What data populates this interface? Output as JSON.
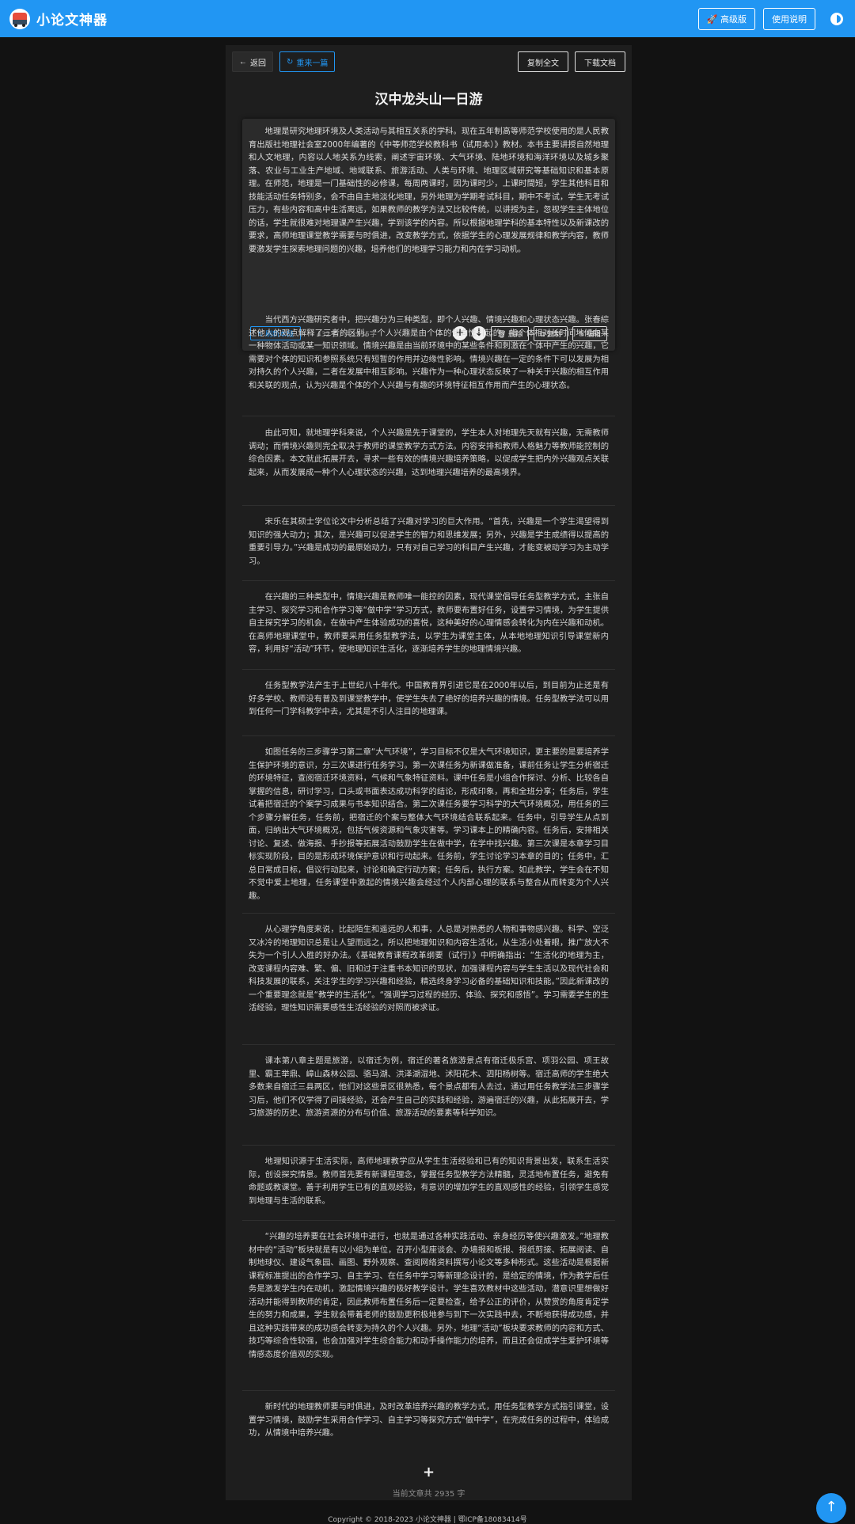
{
  "navbar": {
    "brand": "小论文神器",
    "premium_label": "🚀 高级版",
    "help_label": "使用说明"
  },
  "toolbar": {
    "back_label": "返回",
    "regen_label": "重来一篇",
    "copy_all_label": "复制全文",
    "download_label": "下载文档"
  },
  "article": {
    "title": "汉中龙头山一日游",
    "paragraphs": [
      "地理是研究地理环境及人类活动与其相互关系的学科。现在五年制高等师范学校使用的是人民教育出版社地理社会室2000年编著的《中等师范学校教科书（试用本）》教材。本书主要讲授自然地理和人文地理，内容以人地关系为线索，阐述宇宙环境、大气环境、陆地环境和海洋环境以及城乡聚落、农业与工业生产地域、地域联系、旅游活动、人类与环境、地理区域研究等基础知识和基本原理。在师范，地理是一门基础性的必修课，每周两课时，因为课时少，上课时間短，学生其他科目和技能活动任务特别多，会不由自主地淡化地理，另外地理为学期考试科目，期中不考试，学生无考试压力，有些内容和高中生活离远，如果教师的教学方法又比较传统，以讲授为主，忽视学生主体地位的话，学生就很难对地理课产生兴趣，学到该学的内容。所以根据地理学科的基本特性以及新课改的要求，高师地理课堂教学需要与时俱进，改变教学方式，依据学生的心理发展规律和教学内容，教师要激发学生探索地理问题的兴趣，培养他们的地理学习能力和内在学习动机。",
      "当代西方兴趣研究者中，把兴趣分为三种类型，即个人兴趣、情境兴趣和心理状态兴趣。张春綜述他人的观点解释了三者的区别。“个人兴趣是由个体的倾向性引起的，指个体相对长时间地倾向某一种物体活动或某一知识领域。情境兴趣是由当前环境中的某些条件和刺激在个体中产生的兴趣，它需要对个体的知识和参照系统只有短暂的作用并边缘性影响。情境兴趣在一定的条件下可以发展为相对持久的个人兴趣，二者在发展中相互影响。兴趣作为一种心理状态反映了一种关于兴趣的相互作用和关联的观点，认为兴趣是个体的个人兴趣与有趣的环境特征相互作用而产生的心理状态。",
      "由此可知，就地理学科来说，个人兴趣是先于课堂的，学生本人对地理先天就有兴趣，无需教师调动；而情境兴趣则完全取决于教师的课堂教学方式方法。内容安排和教师人格魅力等教师能控制的综合因素。本文就此拓展开去，寻求一些有效的情境兴趣培养策略，以促成学生把内外兴趣观点关联起来，从而发展成一种个人心理状态的兴趣，达到地理兴趣培养的最高境界。",
      "宋乐在其硕士学位论文中分析总结了兴趣对学习的巨大作用。“首先，兴趣是一个学生渴望得到知识的强大动力；其次，是兴趣可以促进学生的智力和思维发展；另外，兴趣是学生成绩得以提高的重要引导力。”兴趣是成功的最原始动力，只有对自己学习的科目产生兴趣，才能变被动学习为主动学习。",
      "在兴趣的三种类型中，情境兴趣是教师唯一能控的因素，现代课堂倡导任务型教学方式，主张自主学习、探究学习和合作学习等“做中学”学习方式，教师要布置好任务，设置学习情境，为学生提供自主探究学习的机会，在做中产生体验成功的喜悦，这种美好的心理情感会转化为内在兴趣和动机。在高师地理课堂中，教师要采用任务型教学法，以学生为课堂主体，从本地地理知识引导课堂新内容，利用好“活动”环节，使地理知识生活化，逐渐培养学生的地理情境兴趣。",
      "任务型教学法产生于上世纪八十年代。中国教育界引进它是在2000年以后，到目前为止还是有好多学校、教师没有普及到课堂教学中，使学生失去了绝好的培养兴趣的情境。任务型教学法可以用到任何一门学科教学中去，尤其是不引人注目的地理课。",
      "如图任务的三步骤学习第二章“大气环境”，学习目标不仅是大气环境知识，更主要的是要培养学生保护环境的意识，分三次课进行任务学习。第一次课任务为新课做准备，课前任务让学生分析宿迁的环境特征，查阅宿迁环境资料，气候和气象特征资料。课中任务是小组合作探讨、分析、比较各自掌握的信息，研讨学习，口头或书面表达成功科学的结论，形成印象，再和全班分享；任务后，学生试着把宿迁的个案学习成果与书本知识结合。第二次课任务要学习科学的大气环境概况，用任务的三个步骤分解任务，任务前，把宿迁的个案与整体大气环境结合联系起来。任务中，引导学生从点到面，归纳出大气环境概况，包括气候资源和气象灾害等。学习课本上的精确内容。任务后，安排相关讨论、复述、做海报、手抄报等拓展活动鼓励学生在做中学，在学中找兴趣。第三次课是本章学习目标实现阶段，目的是形成环境保护意识和行动起来。任务前，学生讨论学习本章的目的；任务中，汇总日常成日标，倡议行动起来，讨论和确定行动方案；任务后，执行方案。如此教学，学生会在不知不觉中爱上地理，任务课堂中激起的情境兴趣会经过个人内部心理的联系与整合从而转变为个人兴趣。",
      "从心理学角度来说，比起陌生和遥远的人和事，人总是对熟悉的人物和事物感兴趣。科学、空泛又冰冷的地理知识总是让人望而远之，所以把地理知识和内容生活化，从生活小处着眼，推广放大不失为一个引人入胜的好办法。《基础教育课程改革纲要（试行）》中明确指出：“生活化的地理为主，改变课程内容难、繁、偏、旧和过于注重书本知识的现状，加强课程内容与学生生活以及现代社会和科技发展的联系，关注学生的学习兴趣和经验，精选终身学习必备的基础知识和技能。”因此新课改的一个重要理念就是“教学的生活化”。“强调学习过程的经历、体验、探究和感悟”。学习需要学生的生活经验，理性知识需要感性生活经验的对照而被求证。",
      "课本第八章主题是旅游，以宿迁为例，宿迁的著名旅游景点有宿迁极乐宫、项羽公园、项王故里、霸王举鼎、嶂山森林公园、骆马湖、洪泽湖湿地、沭阳花木、泗阳杨树等。宿迁高师的学生绝大多数来自宿迁三县两区，他们对这些景区很熟悉，每个景点都有人去过，通过用任务教学法三步骤学习后，他们不仅学得了间接经验，还会产生自己的实践和经验，游遍宿迁的兴趣，从此拓展开去，学习旅游的历史、旅游资源的分布与价值、旅游活动的要素等科学知识。",
      "地理知识源于生活实际，高师地理教学应从学生生活经验和已有的知识背景出发，联系生活实际，创设探究情景。教师首先要有新课程理念，掌握任务型教学方法精髓，灵活地布置任务，避免有命题或教课堂。善于利用学生已有的直观经验，有意识的增加学生的直观感性的经验，引领学生感觉到地理与生活的联系。",
      "“兴趣的培养要在社会环境中进行，也就是通过各种实践活动、亲身经历等使兴趣激发。”地理教材中的“活动”板块就是有以小组为单位，召开小型座谈会、办墙报和板报、报纸剪接、拓展阅读、自制地球仪、建设气象园、画图、野外观察、查阅网络资料撰写小论文等多种形式。这些活动是根据新课程标准提出的合作学习、自主学习、在任务中学习等新理念设计的，是给定的情境，作为教学后任务是激发学生内在动机，激起情境兴趣的极好教学设计。学生喜欢教材中这些活动，潜意识里想做好活动并能得到教师的肯定，因此教师布置任务后一定要检查，给予公正的评价，从赞赏的角度肯定学生的努力和成果，学生就会带着老师的鼓励更积极地参与到下一次实践中去，不断地获得成功感，并且这种实践带来的成功感会转变为持久的个人兴趣。另外，地理“活动”板块要求教师的内容和方式、技巧等综合性较强，也会加强对学生综合能力和动手操作能力的培养，而且还会促成学生爱护环境等情感态度价值观的实现。",
      "新时代的地理教师要与时俱进，及时改革培养兴趣的教学方式，用任务型教学方式指引课堂，设置学习情境，鼓励学生采用合作学习、自主学习等探究方式“做中学”，在完成任务的过程中，体验成功，从情境中培养兴趣。"
    ]
  },
  "active_card": {
    "refresh_label": "刷新本段",
    "count_label": "432字 / 共2935字",
    "delete_label": "删除",
    "copy_label": "复制",
    "edit_label": "编辑"
  },
  "summary": {
    "total_label": "当前文章共 2935 字"
  },
  "footer": {
    "copyright": "Copyright © 2018-2023 小论文神器 | 鄂ICP备18083414号"
  },
  "colors": {
    "accent": "#2196f3",
    "background": "#121212",
    "panel": "#1e1e1e"
  }
}
